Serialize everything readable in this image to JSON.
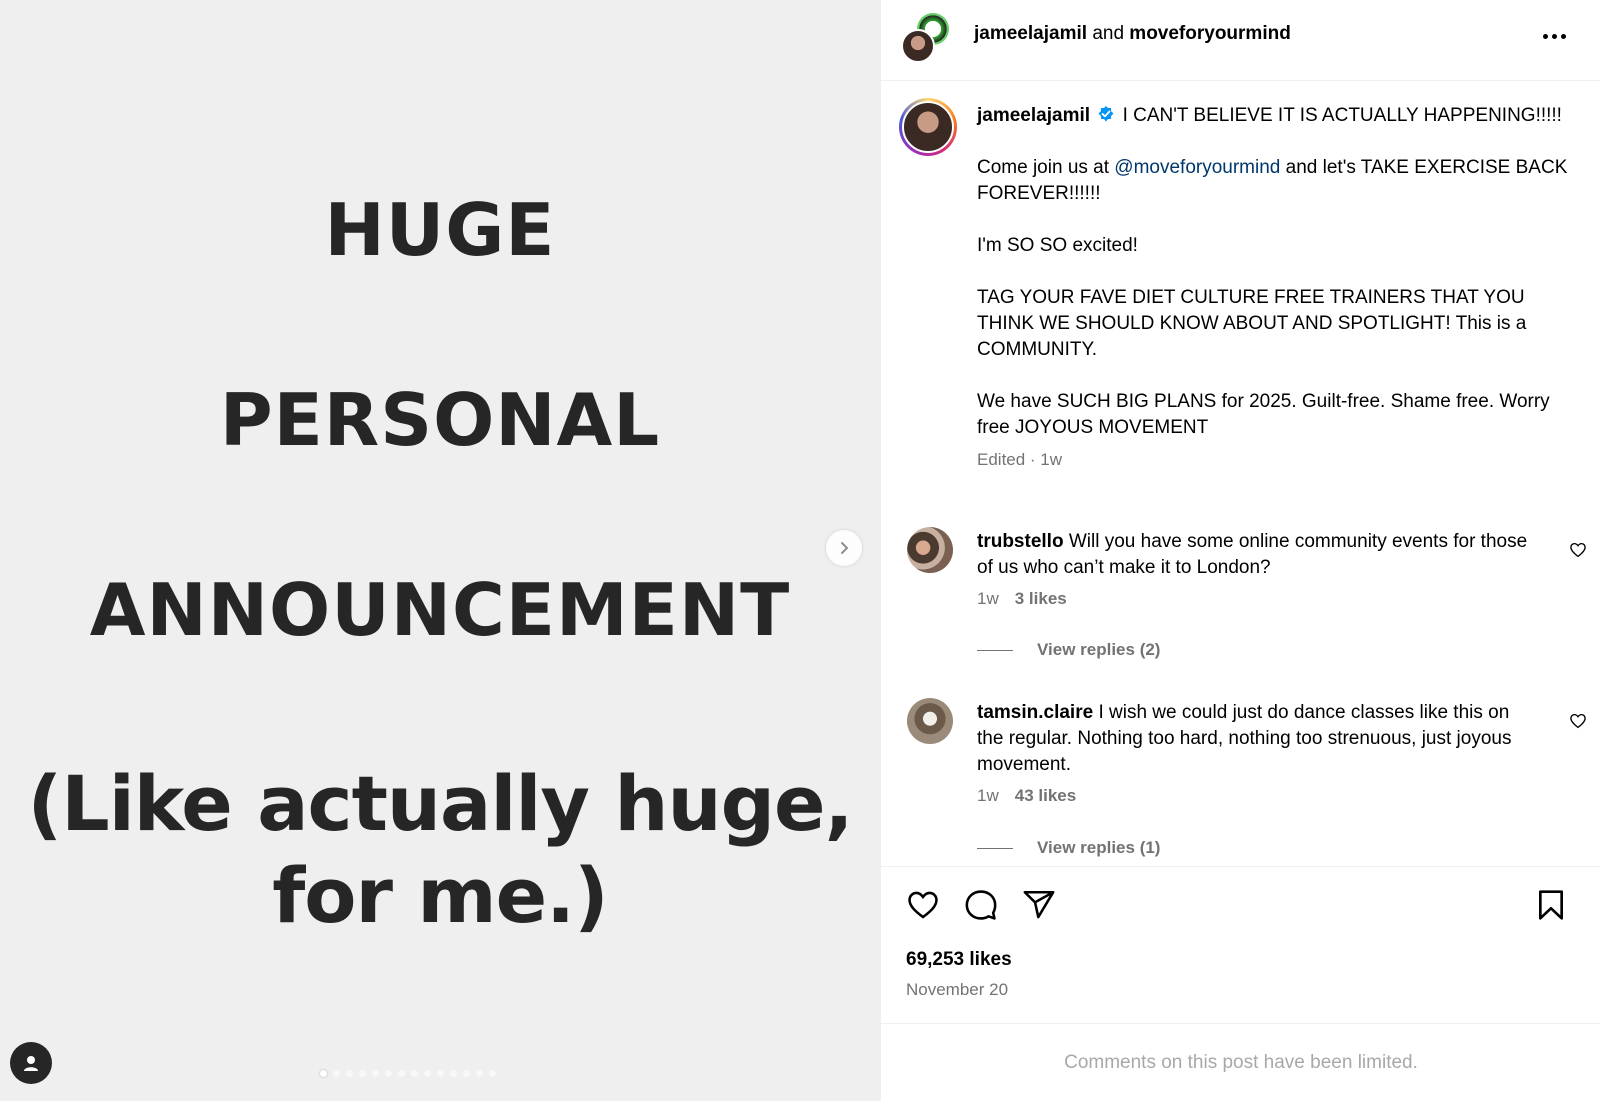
{
  "media": {
    "lines": [
      "HUGE",
      "PERSONAL",
      "ANNOUNCEMENT",
      "(Like actually huge,",
      "for me.)"
    ],
    "slide_count": 14,
    "active_slide": 1
  },
  "header": {
    "user1": "jameelajamil",
    "conjunction": "and",
    "user2": "moveforyourmind"
  },
  "caption": {
    "username": "jameelajamil",
    "first_line": "I CAN'T BELIEVE IT IS ACTUALLY HAPPENING!!!!!",
    "p2_before": "Come join us at ",
    "p2_mention": "@moveforyourmind",
    "p2_after": " and let's TAKE EXERCISE BACK FOREVER!!!!!!",
    "p3": "I'm SO SO excited!",
    "p4": "TAG YOUR FAVE DIET CULTURE FREE TRAINERS THAT YOU THINK WE SHOULD KNOW ABOUT AND SPOTLIGHT! This is a COMMUNITY.",
    "p5": "We have SUCH BIG PLANS for 2025. Guilt-free. Shame free. Worry free JOYOUS MOVEMENT",
    "meta": "Edited · 1w"
  },
  "comments": [
    {
      "username": "trubstello",
      "text": "Will you have some online community events for those of us who can’t make it to London?",
      "age": "1w",
      "likes": "3 likes",
      "replies": "View replies (2)"
    },
    {
      "username": "tamsin.claire",
      "text": "I wish we could just do dance classes like this on the regular. Nothing too hard, nothing too strenuous, just joyous movement.",
      "age": "1w",
      "likes": "43 likes",
      "replies": "View replies (1)"
    }
  ],
  "actions": {
    "likes": "69,253 likes",
    "date": "November 20"
  },
  "footer": {
    "limited": "Comments on this post have been limited."
  },
  "colors": {
    "mention": "#00376b",
    "verified": "#0095f6",
    "secondary_text": "#737373"
  }
}
